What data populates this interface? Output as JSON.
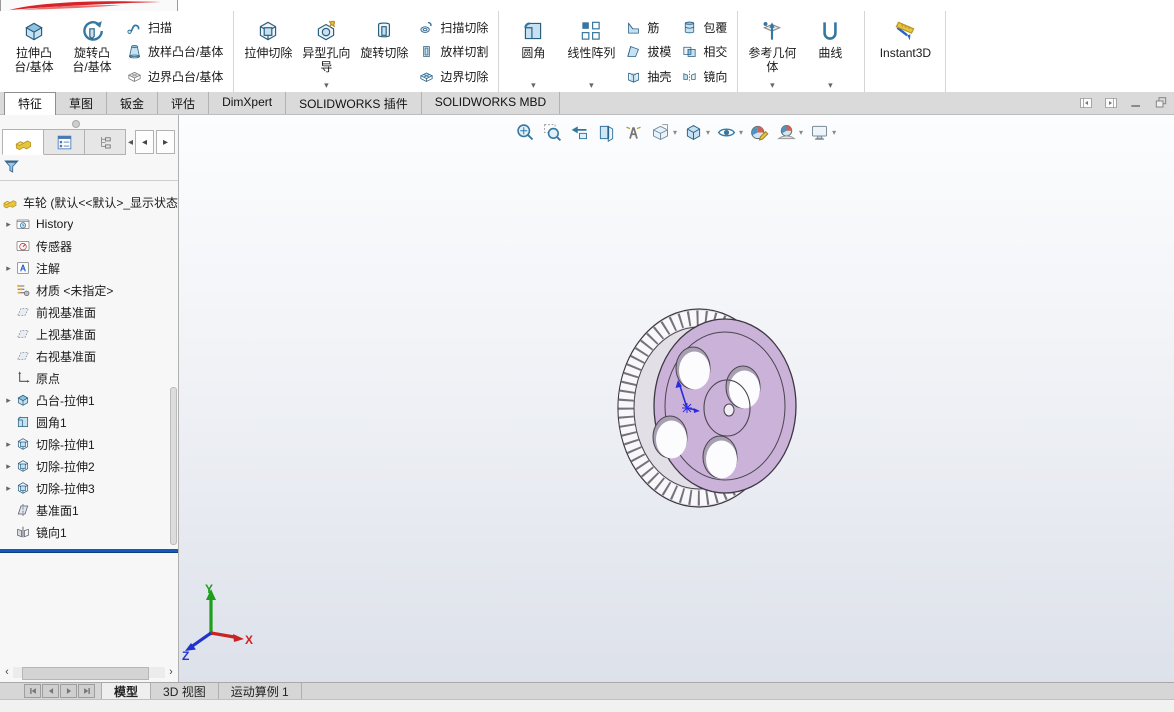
{
  "colors": {
    "accent_red": "#d6232a",
    "icon_blue": "#3577a0",
    "wheel_face": "#cbb2d8",
    "rollback_bar": "#1759b7"
  },
  "ribbon": {
    "groups": [
      {
        "items": [
          {
            "kind": "big",
            "label": "拉伸凸台/基体",
            "icon": "extruded-boss"
          },
          {
            "kind": "big",
            "label": "旋转凸台/基体",
            "icon": "revolved-boss"
          },
          {
            "kind": "col",
            "buttons": [
              {
                "label": "扫描",
                "icon": "sweep"
              },
              {
                "label": "放样凸台/基体",
                "icon": "lofted-boss"
              },
              {
                "label": "边界凸台/基体",
                "icon": "boundary-boss"
              }
            ]
          }
        ]
      },
      {
        "items": [
          {
            "kind": "big",
            "label": "拉伸切除",
            "icon": "extruded-cut"
          },
          {
            "kind": "big",
            "label": "异型孔向导",
            "icon": "hole-wizard",
            "dropdown": true
          },
          {
            "kind": "big",
            "label": "旋转切除",
            "icon": "revolved-cut"
          },
          {
            "kind": "col",
            "buttons": [
              {
                "label": "扫描切除",
                "icon": "swept-cut"
              },
              {
                "label": "放样切割",
                "icon": "lofted-cut"
              },
              {
                "label": "边界切除",
                "icon": "boundary-cut"
              }
            ]
          }
        ]
      },
      {
        "items": [
          {
            "kind": "big",
            "label": "圆角",
            "icon": "fillet",
            "dropdown": true
          },
          {
            "kind": "big",
            "label": "线性阵列",
            "icon": "linear-pattern",
            "dropdown": true
          },
          {
            "kind": "col",
            "buttons": [
              {
                "label": "筋",
                "icon": "rib"
              },
              {
                "label": "拔模",
                "icon": "draft"
              },
              {
                "label": "抽壳",
                "icon": "shell"
              }
            ]
          },
          {
            "kind": "col",
            "buttons": [
              {
                "label": "包覆",
                "icon": "wrap"
              },
              {
                "label": "相交",
                "icon": "intersect"
              },
              {
                "label": "镜向",
                "icon": "mirror"
              }
            ]
          }
        ]
      },
      {
        "items": [
          {
            "kind": "big",
            "label": "参考几何体",
            "icon": "reference-geometry",
            "dropdown": true
          },
          {
            "kind": "big",
            "label": "曲线",
            "icon": "curves",
            "dropdown": true
          }
        ]
      },
      {
        "items": [
          {
            "kind": "big",
            "label": "Instant3D",
            "icon": "instant3d"
          }
        ]
      }
    ]
  },
  "command_tabs": [
    {
      "label": "特征",
      "active": true
    },
    {
      "label": "草图",
      "active": false
    },
    {
      "label": "钣金",
      "active": false
    },
    {
      "label": "评估",
      "active": false
    },
    {
      "label": "DimXpert",
      "active": false
    },
    {
      "label": "SOLIDWORKS 插件",
      "active": false
    },
    {
      "label": "SOLIDWORKS MBD",
      "active": false
    }
  ],
  "window_controls": [
    {
      "name": "pane-left"
    },
    {
      "name": "pane-right"
    },
    {
      "name": "minimize-window"
    },
    {
      "name": "restore-window"
    }
  ],
  "panel_tabs": [
    {
      "name": "featuremanager-tab",
      "icon": "part",
      "active": true
    },
    {
      "name": "propertymanager-tab",
      "icon": "property",
      "active": false
    },
    {
      "name": "configurationmanager-tab",
      "icon": "config",
      "active": false
    }
  ],
  "feature_tree": {
    "filter_icon": "filter",
    "items": [
      {
        "label": "车轮 (默认<<默认>_显示状态",
        "icon": "part",
        "root": true,
        "arrow": false
      },
      {
        "label": "History",
        "icon": "history",
        "arrow": true
      },
      {
        "label": "传感器",
        "icon": "sensors",
        "arrow": false
      },
      {
        "label": "注解",
        "icon": "annotations",
        "arrow": true
      },
      {
        "label": "材质 <未指定>",
        "icon": "material",
        "arrow": false
      },
      {
        "label": "前视基准面",
        "icon": "plane",
        "arrow": false
      },
      {
        "label": "上视基准面",
        "icon": "plane",
        "arrow": false
      },
      {
        "label": "右视基准面",
        "icon": "plane",
        "arrow": false
      },
      {
        "label": "原点",
        "icon": "origin",
        "arrow": false
      },
      {
        "label": "凸台-拉伸1",
        "icon": "extruded-boss",
        "arrow": true
      },
      {
        "label": "圆角1",
        "icon": "fillet",
        "arrow": false
      },
      {
        "label": "切除-拉伸1",
        "icon": "extruded-cut",
        "arrow": true
      },
      {
        "label": "切除-拉伸2",
        "icon": "extruded-cut",
        "arrow": true
      },
      {
        "label": "切除-拉伸3",
        "icon": "extruded-cut",
        "arrow": true
      },
      {
        "label": "基准面1",
        "icon": "plane-feature",
        "arrow": false
      },
      {
        "label": "镜向1",
        "icon": "mirror-feature",
        "arrow": false
      }
    ]
  },
  "headsup_toolbar": [
    {
      "name": "zoom-to-fit",
      "dropdown": false
    },
    {
      "name": "zoom-to-area",
      "dropdown": false
    },
    {
      "name": "previous-view",
      "dropdown": false
    },
    {
      "name": "section-view",
      "dropdown": false
    },
    {
      "name": "annotation-visibility",
      "dropdown": false
    },
    {
      "name": "view-orientation",
      "dropdown": true
    },
    {
      "name": "display-style",
      "dropdown": true
    },
    {
      "name": "hide-show-items",
      "dropdown": true
    },
    {
      "name": "edit-appearance",
      "dropdown": false
    },
    {
      "name": "apply-scene",
      "dropdown": true
    },
    {
      "name": "view-settings",
      "dropdown": true
    }
  ],
  "triad": {
    "x": "X",
    "y": "Y",
    "z": "Z"
  },
  "bottom": {
    "nav": [
      {
        "name": "first-study"
      },
      {
        "name": "previous-study"
      },
      {
        "name": "next-study"
      },
      {
        "name": "last-study"
      }
    ],
    "tabs": [
      {
        "label": "模型",
        "active": true
      },
      {
        "label": "3D 视图",
        "active": false
      },
      {
        "label": "运动算例 1",
        "active": false
      }
    ]
  }
}
